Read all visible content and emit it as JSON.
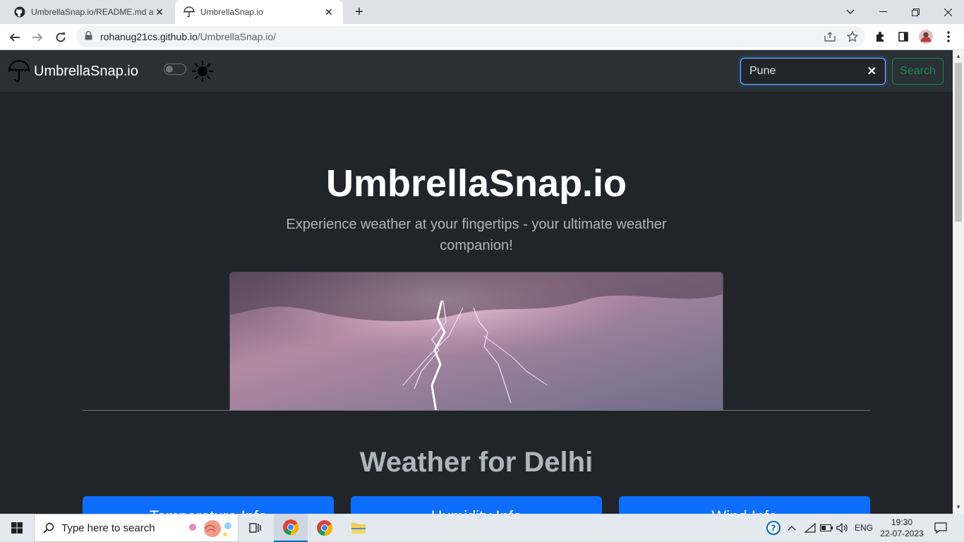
{
  "browser": {
    "tabs": [
      {
        "title": "UmbrellaSnap.io/README.md at",
        "active": false,
        "favicon": "github-icon"
      },
      {
        "title": "UmbrellaSnap.io",
        "active": true,
        "favicon": "umbrella-icon"
      }
    ],
    "url_host": "rohanug21cs.github.io",
    "url_path": "/UmbrellaSnap.io/"
  },
  "navbar": {
    "brand": "UmbrellaSnap.io",
    "search_value": "Pune",
    "search_button": "Search"
  },
  "hero": {
    "title": "UmbrellaSnap.io",
    "subtitle": "Experience weather at your fingertips - your ultimate weather companion!"
  },
  "weather": {
    "heading": "Weather for Delhi",
    "cards": [
      "Temperature Info",
      "Humidity Info",
      "Wind Info"
    ]
  },
  "taskbar": {
    "search_placeholder": "Type here to search",
    "language": "ENG",
    "time": "19:30",
    "date": "22-07-2023"
  },
  "colors": {
    "page_bg": "#212529",
    "navbar_bg": "#2b3035",
    "primary": "#0d6efd",
    "success": "#198754"
  }
}
